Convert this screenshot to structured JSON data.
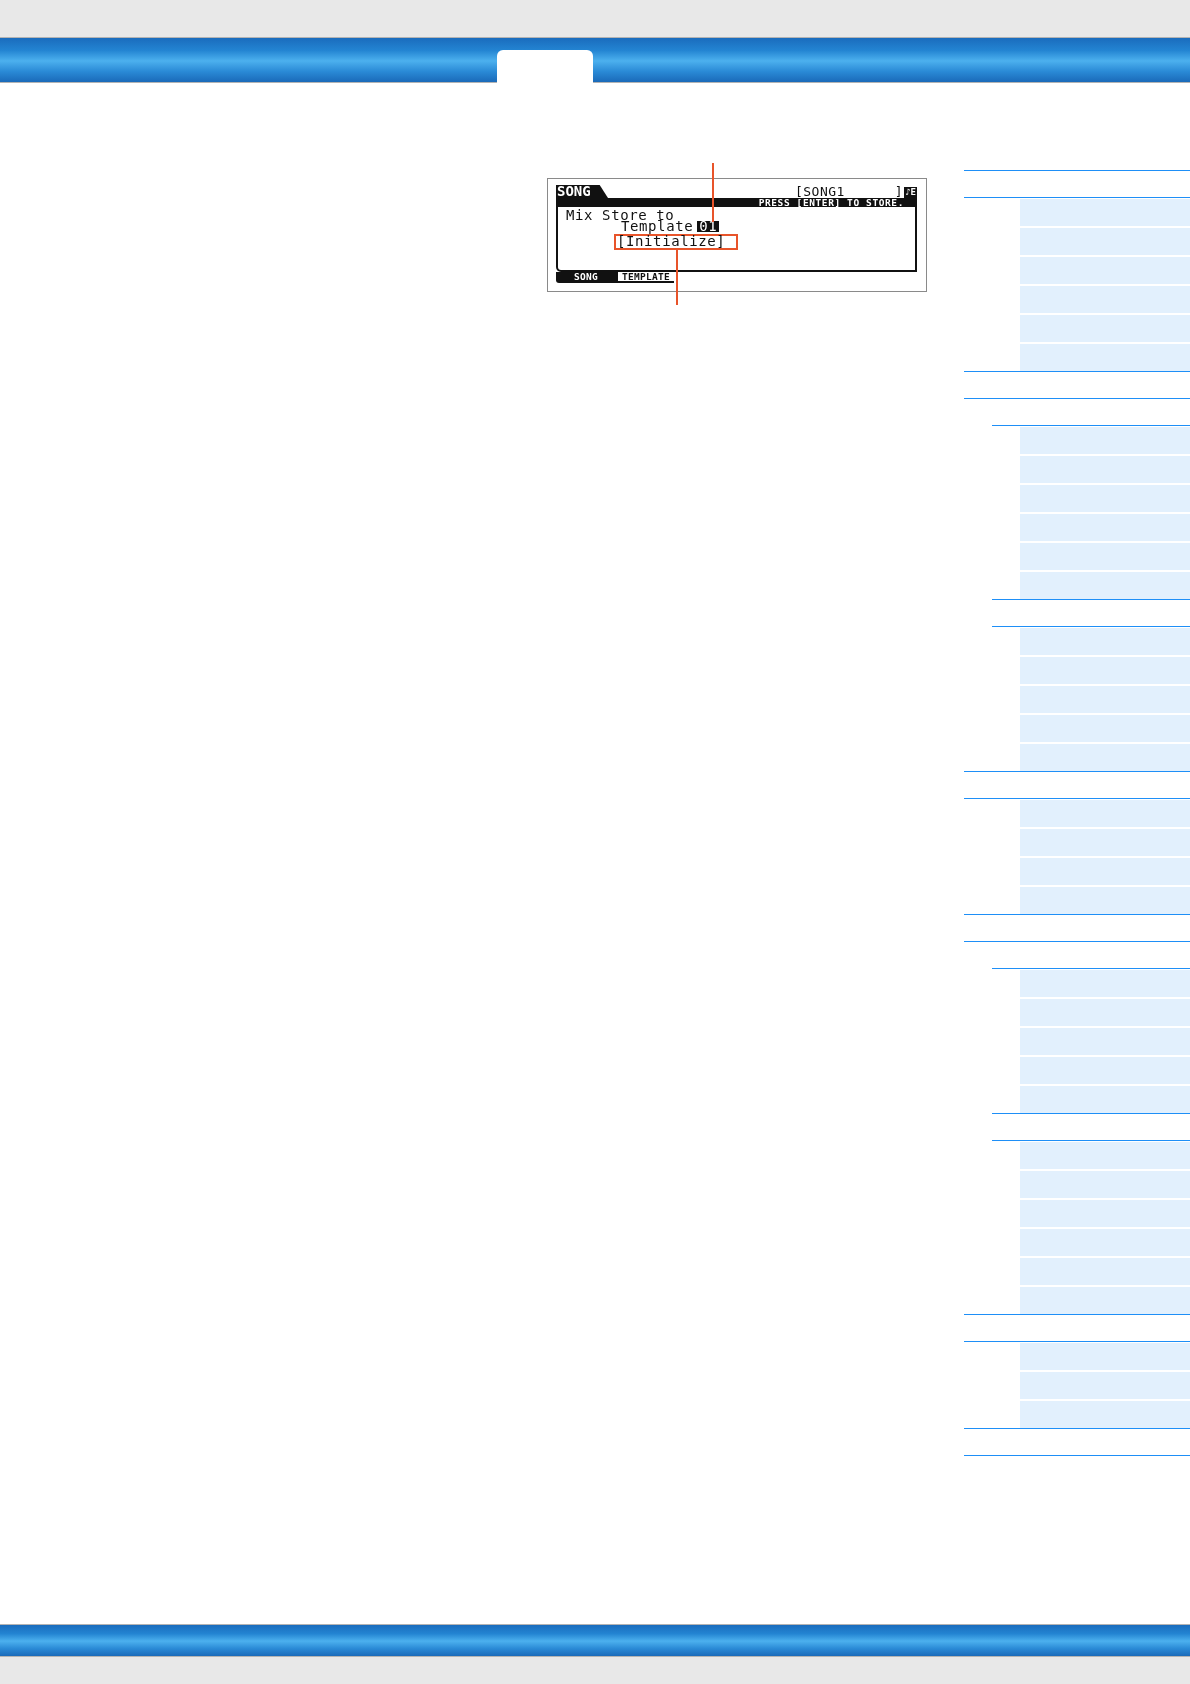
{
  "lcd_screen": {
    "mode": "SONG",
    "song_name": "[SONG1      ]",
    "indicator": "♪E",
    "message": "PRESS [ENTER] TO STORE.",
    "prompt": "Mix Store to",
    "template_label": "Template",
    "template_number": {
      "value": "01",
      "highlighted": true
    },
    "template_name": "[Initialize]",
    "tabs": [
      {
        "label": "SONG",
        "selected": false
      },
      {
        "label": "TEMPLATE",
        "selected": true
      }
    ]
  },
  "sidebar": {
    "items": [
      {
        "kind": "section",
        "children": [
          {
            "kind": "link"
          },
          {
            "kind": "link"
          },
          {
            "kind": "link"
          },
          {
            "kind": "link"
          },
          {
            "kind": "link"
          },
          {
            "kind": "link"
          }
        ]
      },
      {
        "kind": "section",
        "children": [
          {
            "kind": "subsection",
            "children": [
              {
                "kind": "link"
              },
              {
                "kind": "link"
              },
              {
                "kind": "link"
              },
              {
                "kind": "link"
              },
              {
                "kind": "link"
              },
              {
                "kind": "link"
              }
            ]
          },
          {
            "kind": "subsection",
            "children": [
              {
                "kind": "link"
              },
              {
                "kind": "link"
              },
              {
                "kind": "link"
              },
              {
                "kind": "link"
              },
              {
                "kind": "link"
              }
            ]
          }
        ]
      },
      {
        "kind": "section",
        "children": [
          {
            "kind": "link"
          },
          {
            "kind": "link"
          },
          {
            "kind": "link"
          },
          {
            "kind": "link"
          }
        ]
      },
      {
        "kind": "section",
        "children": [
          {
            "kind": "subsection",
            "children": [
              {
                "kind": "link"
              },
              {
                "kind": "link"
              },
              {
                "kind": "link"
              },
              {
                "kind": "link"
              },
              {
                "kind": "link"
              }
            ]
          },
          {
            "kind": "subsection",
            "children": [
              {
                "kind": "link"
              },
              {
                "kind": "link"
              },
              {
                "kind": "link"
              },
              {
                "kind": "link"
              },
              {
                "kind": "link"
              },
              {
                "kind": "link"
              }
            ]
          }
        ]
      },
      {
        "kind": "section",
        "children": [
          {
            "kind": "link"
          },
          {
            "kind": "link"
          },
          {
            "kind": "link"
          }
        ]
      },
      {
        "kind": "section"
      }
    ]
  }
}
